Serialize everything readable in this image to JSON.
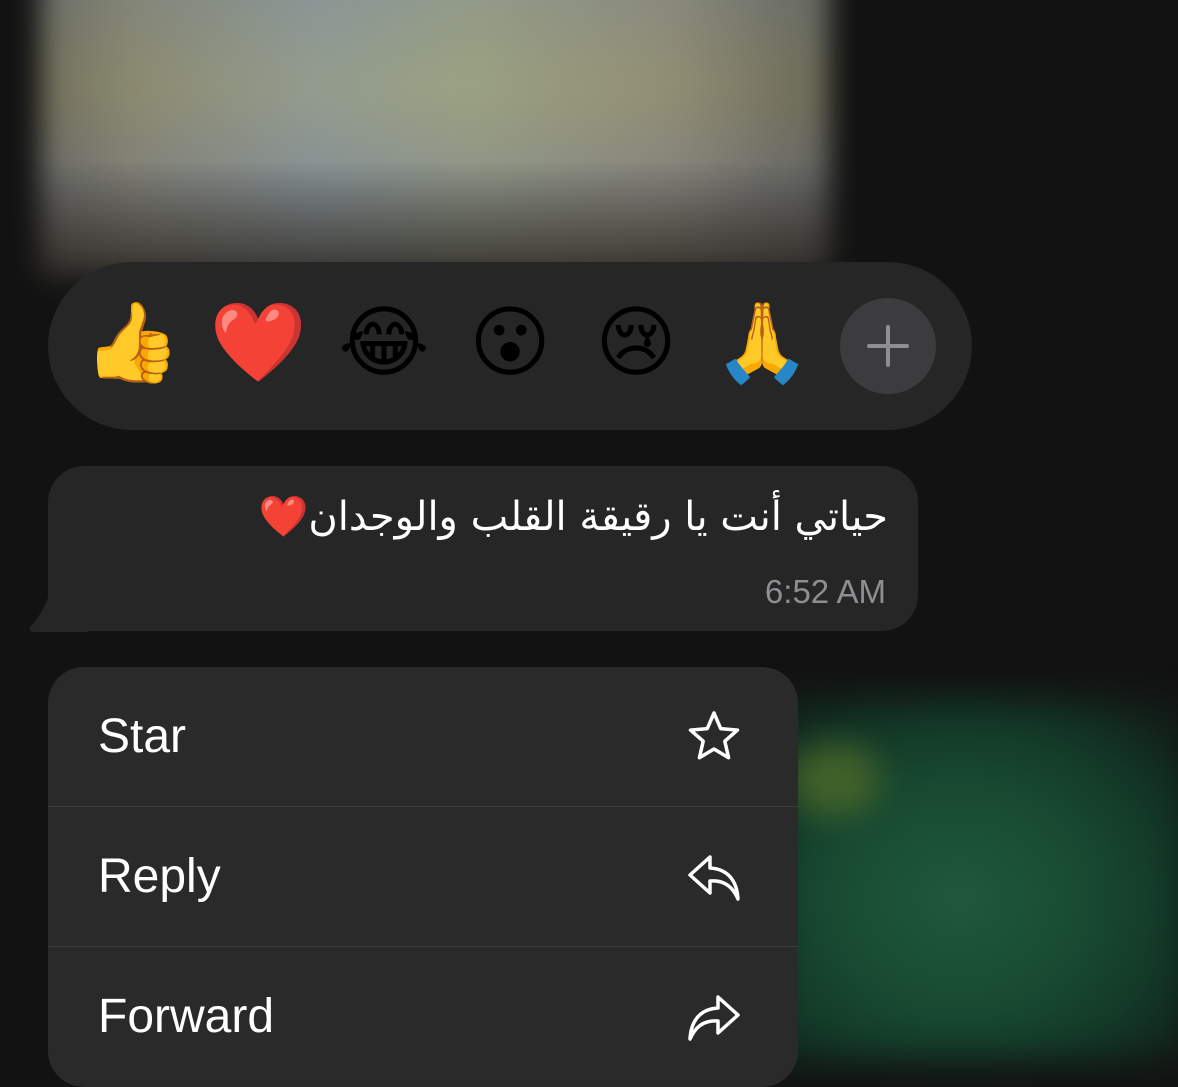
{
  "reactions": {
    "emojis": [
      {
        "char": "👍",
        "name": "thumbs-up"
      },
      {
        "char": "❤️",
        "name": "red-heart"
      },
      {
        "char": "😂",
        "name": "tears-of-joy"
      },
      {
        "char": "😮",
        "name": "surprised"
      },
      {
        "char": "😢",
        "name": "crying"
      },
      {
        "char": "🙏",
        "name": "folded-hands"
      }
    ],
    "more_icon": "plus-icon"
  },
  "message": {
    "text": "حياتي أنت يا رقيقة القلب والوجدان❤️",
    "time": "6:52 AM"
  },
  "menu": {
    "items": [
      {
        "label": "Star",
        "icon": "star-icon"
      },
      {
        "label": "Reply",
        "icon": "reply-icon"
      },
      {
        "label": "Forward",
        "icon": "forward-icon"
      }
    ]
  },
  "colors": {
    "background": "#121212",
    "surface": "#262626",
    "menu_surface": "#2a2a2a",
    "text_primary": "#ffffff",
    "text_secondary": "#8e8e93",
    "plus_button": "#3c3c3e"
  }
}
